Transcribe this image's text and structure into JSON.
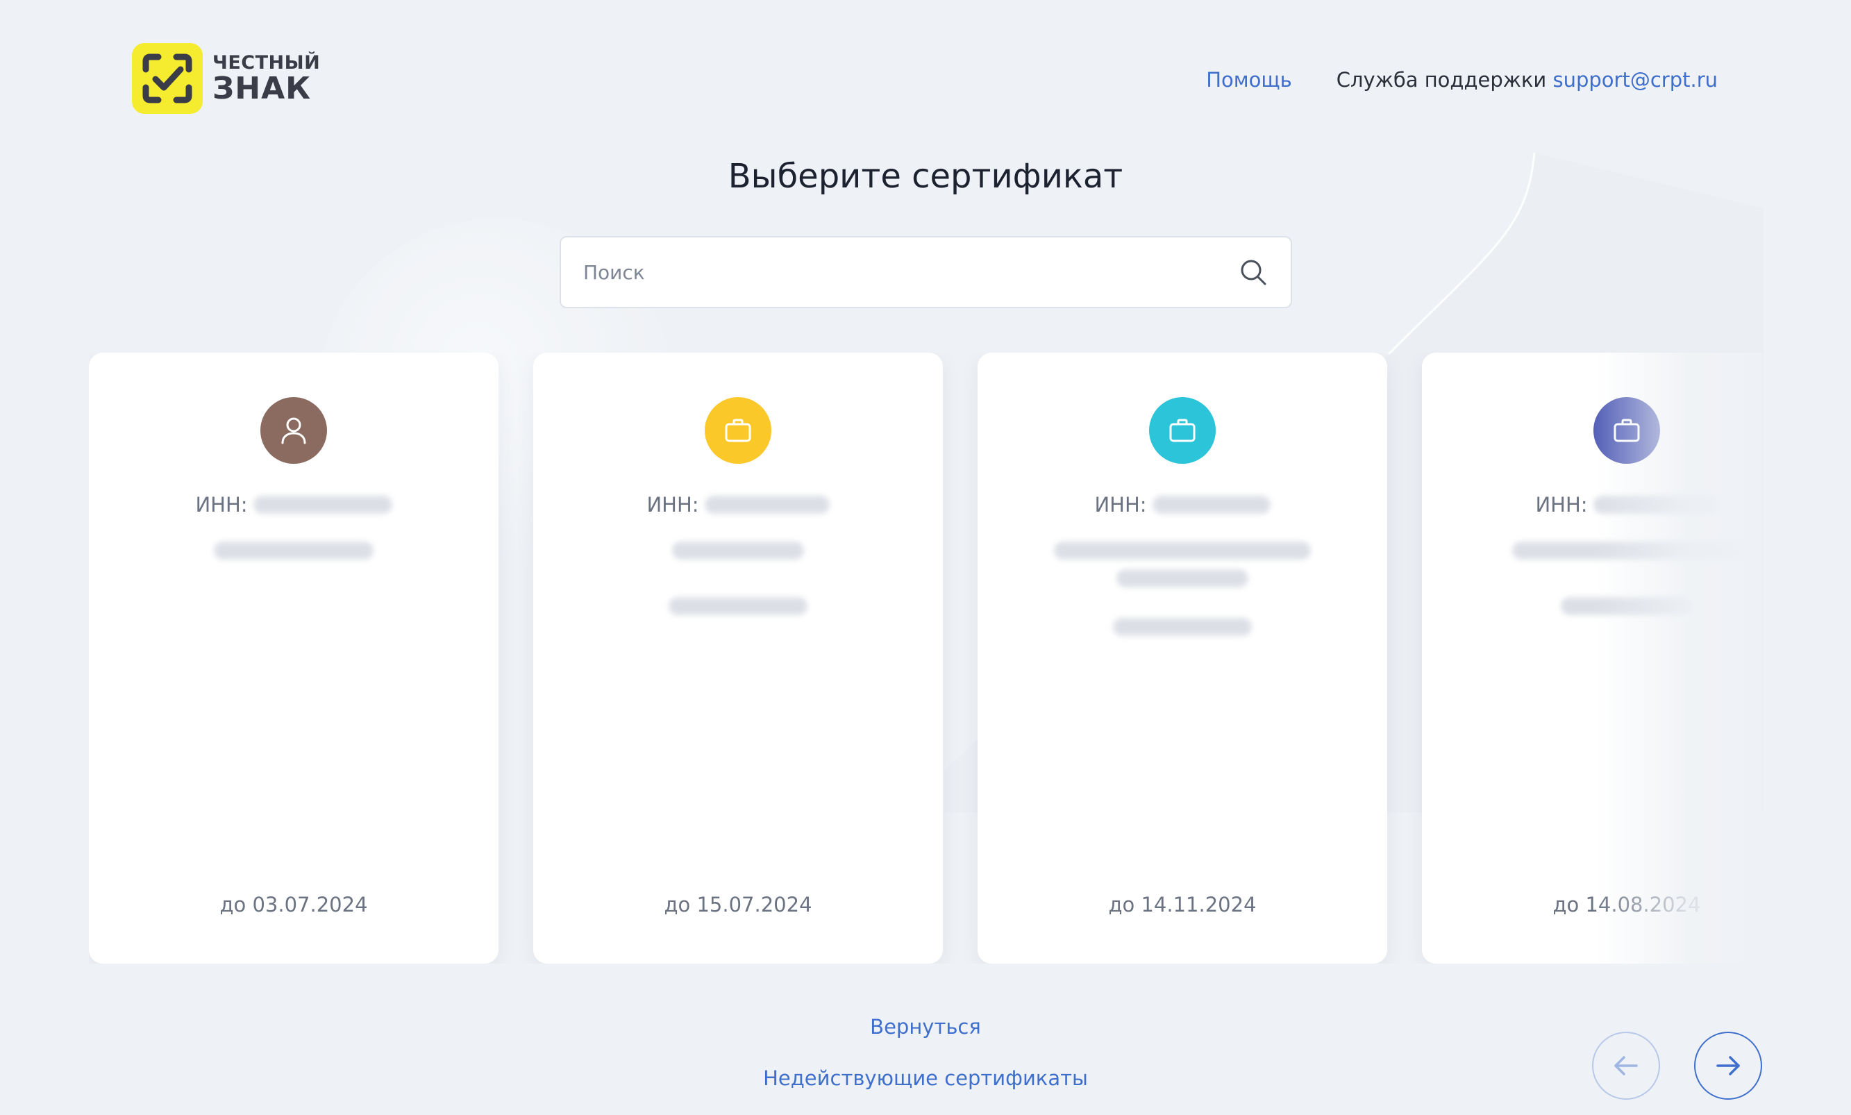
{
  "brand": {
    "line1": "ЧЕСТНЫЙ",
    "line2": "ЗНАК",
    "accent": "#f5ec2f"
  },
  "header": {
    "help_label": "Помощь",
    "support_label": "Служба поддержки",
    "support_email": "support@crpt.ru"
  },
  "page": {
    "title": "Выберите сертификат"
  },
  "search": {
    "placeholder": "Поиск",
    "value": "",
    "icon": "search-icon"
  },
  "certificates": [
    {
      "type": "person",
      "icon": "user-icon",
      "color": "#8b6b5f",
      "inn_label": "ИНН:",
      "valid_until": "до 03.07.2024"
    },
    {
      "type": "organization",
      "icon": "briefcase-icon",
      "color": "#fbc82a",
      "inn_label": "ИНН:",
      "valid_until": "до 15.07.2024"
    },
    {
      "type": "organization",
      "icon": "briefcase-icon",
      "color": "#2bc4d8",
      "inn_label": "ИНН:",
      "valid_until": "до 14.11.2024"
    },
    {
      "type": "organization",
      "icon": "briefcase-icon",
      "color": "#5662b8",
      "inn_label": "ИНН:",
      "valid_until": "до 14.08.2024"
    }
  ],
  "footer": {
    "back_label": "Вернуться",
    "invalid_label": "Недействующие сертификаты"
  },
  "pager": {
    "prev_icon": "arrow-left-icon",
    "next_icon": "arrow-right-icon"
  }
}
